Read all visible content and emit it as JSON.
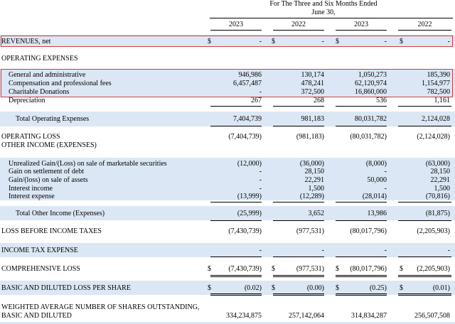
{
  "header": {
    "period_title_line1": "For The Three and Six Months Ended",
    "period_title_line2": "June 30,",
    "years": [
      "2023",
      "2022",
      "2023",
      "2022"
    ]
  },
  "currency_symbol": "$",
  "rows": {
    "revenues": {
      "label": "REVENUES, net",
      "values": [
        "-",
        "-",
        "-",
        "-"
      ]
    },
    "operating_expenses": {
      "label": "OPERATING EXPENSES"
    },
    "general_admin": {
      "label": "General and administrative",
      "values": [
        "946,986",
        "130,174",
        "1,050,273",
        "185,390"
      ]
    },
    "comp_prof_fees": {
      "label": "Compensation and professional fees",
      "values": [
        "6,457,487",
        "478,241",
        "62,120,974",
        "1,154,977"
      ]
    },
    "charitable": {
      "label": "Charitable Donations",
      "values": [
        "-",
        "372,500",
        "16,860,000",
        "782,500"
      ]
    },
    "depreciation": {
      "label": "Depreciation",
      "values": [
        "267",
        "268",
        "536",
        "1,161"
      ]
    },
    "total_opex": {
      "label": "Total Operating Expenses",
      "values": [
        "7,404,739",
        "981,183",
        "80,031,782",
        "2,124,028"
      ]
    },
    "operating_loss": {
      "label": "OPERATING LOSS",
      "values": [
        "(7,404,739)",
        "(981,183)",
        "(80,031,782)",
        "(2,124,028)"
      ]
    },
    "other_income": {
      "label": "OTHER INCOME (EXPENSES)"
    },
    "unrealized": {
      "label": "Unrealized Gain/(Loss) on sale of marketable securities",
      "values": [
        "(12,000)",
        "(36,000)",
        "(8,000)",
        "(63,000)"
      ]
    },
    "gain_debt": {
      "label": "Gain on settlement of debt",
      "values": [
        "-",
        "28,150",
        "-",
        "28,150"
      ]
    },
    "gain_assets": {
      "label": "Gain/(loss) on sale of assets",
      "values": [
        "-",
        "22,291",
        "50,000",
        "22,291"
      ]
    },
    "interest_income": {
      "label": "Interest income",
      "values": [
        "-",
        "1,500",
        "-",
        "1,500"
      ]
    },
    "interest_expense": {
      "label": "Interest expense",
      "values": [
        "(13,999)",
        "(12,289)",
        "(28,014)",
        "(70,816)"
      ]
    },
    "total_other": {
      "label": "Total Other Income (Expenses)",
      "values": [
        "(25,999)",
        "3,652",
        "13,986",
        "(81,875)"
      ]
    },
    "loss_before_tax": {
      "label": "LOSS BEFORE INCOME TAXES",
      "values": [
        "(7,430,739)",
        "(977,531)",
        "(80,017,796)",
        "(2,205,903)"
      ]
    },
    "income_tax": {
      "label": "INCOME TAX EXPENSE",
      "values": [
        "-",
        "-",
        "-",
        "-"
      ]
    },
    "comprehensive_loss": {
      "label": "COMPREHENSIVE LOSS",
      "values": [
        "(7,430,739)",
        "(977,531)",
        "(80,017,796)",
        "(2,205,903)"
      ]
    },
    "eps": {
      "label": "BASIC AND DILUTED LOSS PER SHARE",
      "values": [
        "(0.02)",
        "(0.00)",
        "(0.25)",
        "(0.01)"
      ]
    },
    "weighted_shares": {
      "label_line1": "WEIGHTED AVERAGE NUMBER OF SHARES OUTSTANDING,",
      "label_line2": "BASIC AND DILUTED",
      "values": [
        "334,234,875",
        "257,142,064",
        "314,834,287",
        "256,507,508"
      ]
    }
  }
}
